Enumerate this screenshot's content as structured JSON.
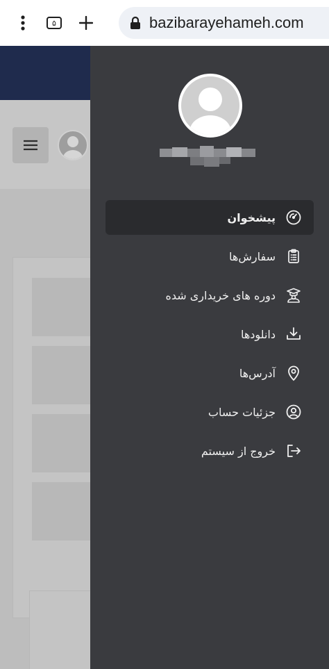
{
  "browser": {
    "url": "bazibarayehameh.com",
    "tab_count": "۵"
  },
  "drawer": {
    "menu": [
      {
        "label": "پیشخوان",
        "icon": "dashboard-gauge-icon",
        "active": true
      },
      {
        "label": "سفارش‌ها",
        "icon": "clipboard-list-icon",
        "active": false
      },
      {
        "label": "دوره های خریداری شده",
        "icon": "graduation-course-icon",
        "active": false
      },
      {
        "label": "دانلودها",
        "icon": "download-tray-icon",
        "active": false
      },
      {
        "label": "آدرس‌ها",
        "icon": "location-pin-icon",
        "active": false
      },
      {
        "label": "جزئیات حساب",
        "icon": "user-circle-icon",
        "active": false
      },
      {
        "label": "خروج از سیستم",
        "icon": "logout-icon",
        "active": false
      }
    ]
  },
  "colors": {
    "drawer_bg": "#3a3b3f",
    "active_item_bg": "#2a2b2e",
    "page_header": "#1f2b4d"
  }
}
